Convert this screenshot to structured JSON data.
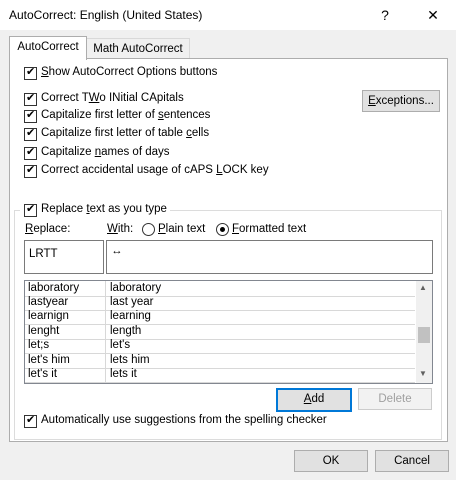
{
  "window": {
    "title": "AutoCorrect: English (United States)",
    "help_glyph": "?",
    "close_glyph": "✕"
  },
  "tabs": [
    {
      "label": "AutoCorrect"
    },
    {
      "label": "Math AutoCorrect"
    }
  ],
  "options": {
    "show_buttons": {
      "pre": "",
      "key": "S",
      "post": "how AutoCorrect Options buttons",
      "checked": true
    },
    "two_initial": {
      "pre": "Correct T",
      "key": "W",
      "post": "o INitial CApitals",
      "checked": true
    },
    "sentences": {
      "pre": "Capitalize first letter of ",
      "key": "s",
      "post": "entences",
      "checked": true
    },
    "table_cells": {
      "pre": "Capitalize first letter of table ",
      "key": "c",
      "post": "ells",
      "checked": true
    },
    "days": {
      "pre": "Capitalize ",
      "key": "n",
      "post": "ames of days",
      "checked": true
    },
    "caps_lock": {
      "pre": "Correct accidental usage of cAPS ",
      "key": "L",
      "post": "OCK key",
      "checked": true
    },
    "replace_as_type": {
      "pre": "Replace ",
      "key": "t",
      "post": "ext as you type",
      "checked": true
    },
    "spelling": {
      "pre": "Automatically use suggestions from the spelling checker",
      "key": "",
      "post": "",
      "checked": true
    }
  },
  "exceptions_button": {
    "pre": "",
    "key": "E",
    "post": "xceptions..."
  },
  "replace_label": {
    "pre": "",
    "key": "R",
    "post": "eplace:"
  },
  "with_label": {
    "pre": "",
    "key": "W",
    "post": "ith:"
  },
  "plain_text": {
    "pre": "",
    "key": "P",
    "post": "lain text",
    "selected": false
  },
  "formatted_text": {
    "pre": "",
    "key": "F",
    "post": "ormatted text",
    "selected": true
  },
  "replace_value": "LRTT",
  "with_value": "↔",
  "entries": [
    {
      "from": "laboratory",
      "to": "laboratory"
    },
    {
      "from": "lastyear",
      "to": "last year"
    },
    {
      "from": "learnign",
      "to": "learning"
    },
    {
      "from": "lenght",
      "to": "length"
    },
    {
      "from": "let;s",
      "to": "let's"
    },
    {
      "from": "let's him",
      "to": "lets him"
    },
    {
      "from": "let's it",
      "to": "lets it"
    }
  ],
  "scroll_up": "▲",
  "scroll_down": "▼",
  "add_button": {
    "pre": "",
    "key": "A",
    "post": "dd"
  },
  "delete_button": "Delete",
  "ok_button": "OK",
  "cancel_button": "Cancel",
  "check_glyph": "✔"
}
